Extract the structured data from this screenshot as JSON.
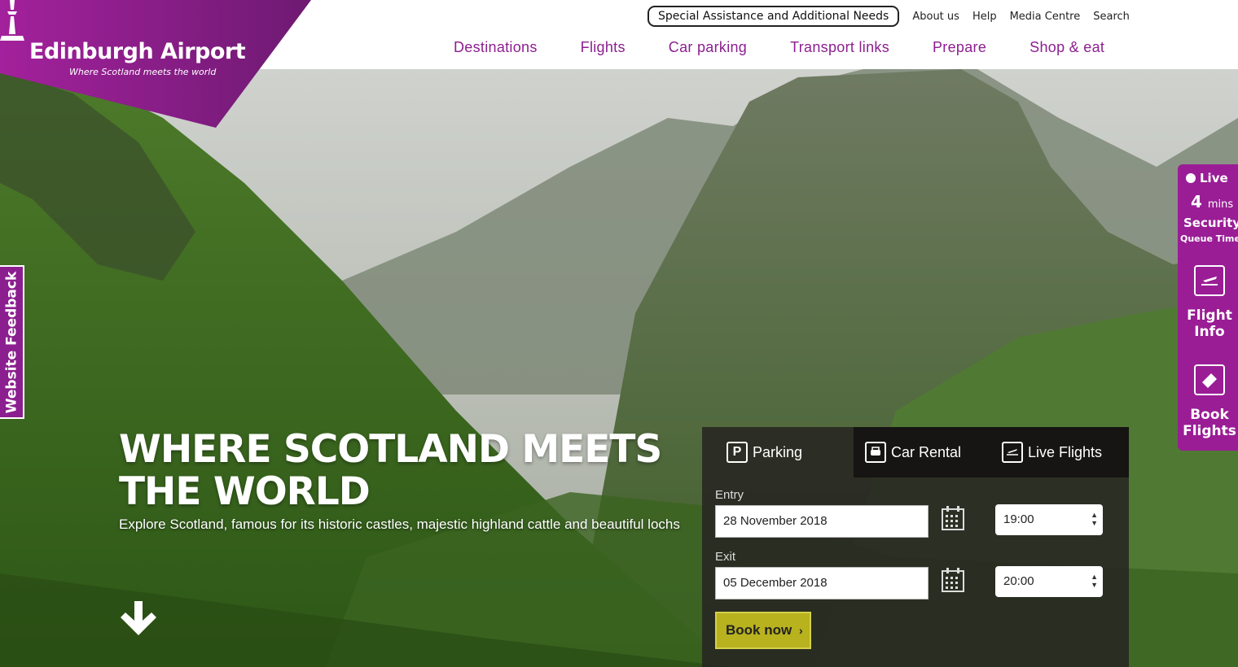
{
  "brand": {
    "name": "Edinburgh Airport",
    "tagline": "Where Scotland meets the world",
    "purple": "#8b1f8f"
  },
  "utility_nav": {
    "assistance": "Special Assistance and Additional Needs",
    "about": "About us",
    "help": "Help",
    "media": "Media Centre",
    "search": "Search"
  },
  "main_nav": [
    "Destinations",
    "Flights",
    "Car parking",
    "Transport links",
    "Prepare",
    "Shop & eat"
  ],
  "feedback": "Website Feedback",
  "widget": {
    "live": "Live",
    "minutes": "4",
    "minutes_unit": "mins",
    "security": "Security",
    "queue_time": "Queue Time",
    "flight_info_1": "Flight",
    "flight_info_2": "Info",
    "book_flights_1": "Book",
    "book_flights_2": "Flights"
  },
  "hero": {
    "headline_1": "WHERE SCOTLAND MEETS",
    "headline_2": "THE WORLD",
    "subline": "Explore Scotland, famous for its historic castles, majestic highland cattle and beautiful lochs"
  },
  "booking": {
    "tabs": [
      "Parking",
      "Car Rental",
      "Live Flights"
    ],
    "entry_label": "Entry",
    "entry_date": "28 November 2018",
    "entry_time": "19:00",
    "exit_label": "Exit",
    "exit_date": "05 December 2018",
    "exit_time": "20:00",
    "book_label": "Book now",
    "book_color": "#b8b21f"
  },
  "icons": [
    "tower-icon",
    "live-dot-icon",
    "flight-info-icon",
    "ticket-icon",
    "parking-icon",
    "car-rental-icon",
    "live-flights-icon",
    "calendar-icon",
    "down-arrow-icon",
    "chevron-right-icon"
  ]
}
